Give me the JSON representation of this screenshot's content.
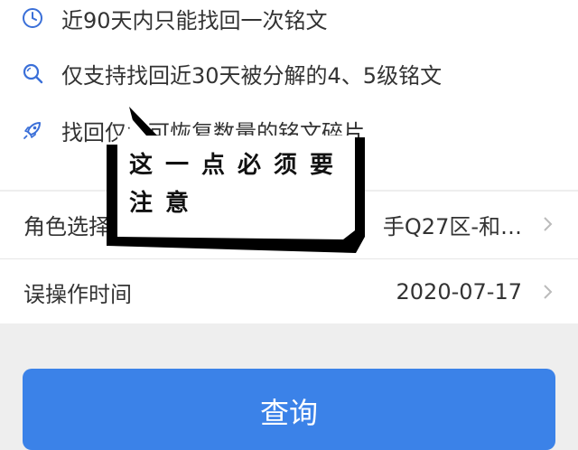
{
  "tips": [
    {
      "icon": "clock-icon",
      "text": "近90天内只能找回一次铭文"
    },
    {
      "icon": "search-icon",
      "text": "仅支持找回近30天被分解的4、5级铭文"
    },
    {
      "icon": "rocket-icon",
      "text": "找回仅为可恢复数量的铭文碎片"
    }
  ],
  "form": {
    "role": {
      "label": "角色选择",
      "value": "手Q27区-和…"
    },
    "time": {
      "label": "误操作时间",
      "value": "2020-07-17"
    }
  },
  "query_button": {
    "label": "查询"
  },
  "annotation": {
    "text": "这一点必须要注意"
  },
  "colors": {
    "accent": "#3b82e8",
    "icon": "#3a6fd8",
    "background": "#eeeeee"
  }
}
